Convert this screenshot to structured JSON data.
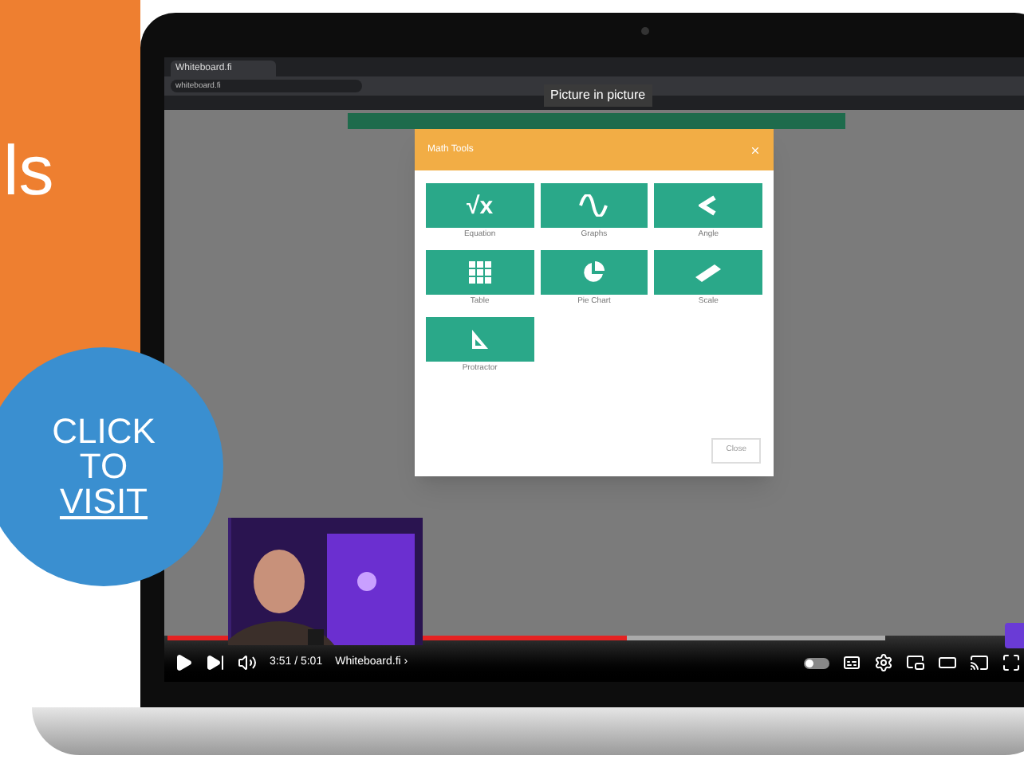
{
  "promo": {
    "heading_fragment": "ls",
    "badge_lines": [
      "CLICK",
      "TO",
      "VISIT"
    ]
  },
  "browser": {
    "tab_title": "Whiteboard.fi",
    "address": "whiteboard.fi",
    "pip_banner": "Picture in picture"
  },
  "dialog": {
    "title": "Math Tools",
    "tools": [
      {
        "kind": "sqrt",
        "symbol": "√x",
        "label": "Equation"
      },
      {
        "kind": "wave",
        "label": "Graphs"
      },
      {
        "kind": "angle",
        "label": "Angle"
      },
      {
        "kind": "grid",
        "label": "Table"
      },
      {
        "kind": "pie",
        "label": "Pie Chart"
      },
      {
        "kind": "ruler",
        "label": "Scale"
      },
      {
        "kind": "triangle",
        "label": "Protractor"
      }
    ],
    "button": "Close"
  },
  "player": {
    "autoplay_on": false,
    "level": 0.64,
    "time": "3:51 / 5:01",
    "chapter": "Whiteboard.fi ›"
  }
}
